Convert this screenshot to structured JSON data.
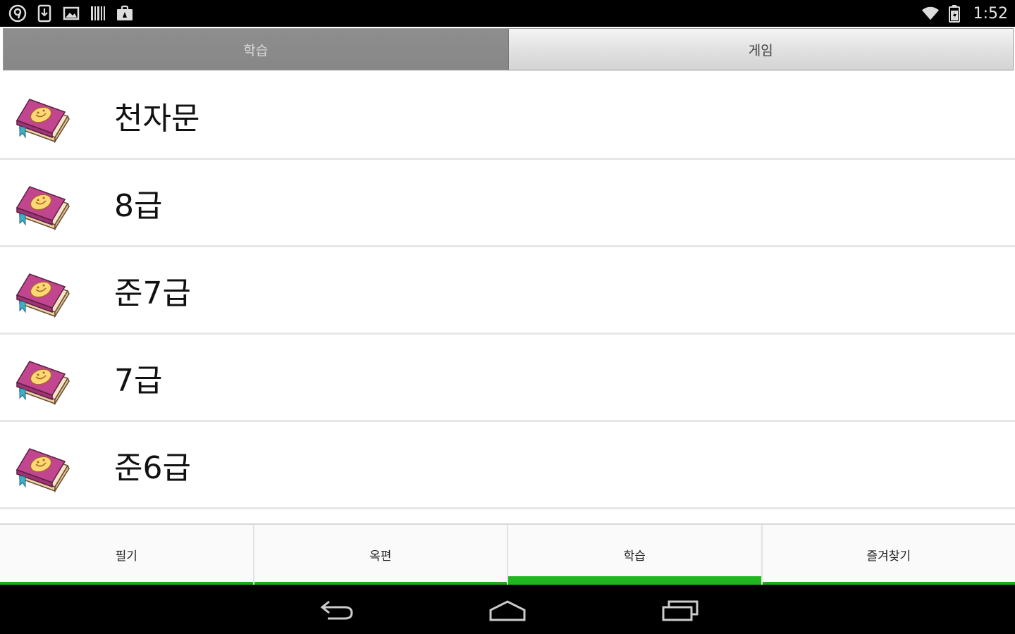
{
  "status_bar": {
    "left_icons": [
      "notification-9-icon",
      "download-icon",
      "image-icon",
      "barcode-icon",
      "shopping-bag-icon"
    ],
    "right_icons": [
      "wifi-icon",
      "battery-icon"
    ],
    "time": "1:52"
  },
  "top_tabs": [
    {
      "label": "학습",
      "active": true
    },
    {
      "label": "게임",
      "active": false
    }
  ],
  "list": {
    "item_icon": "book-icon",
    "items": [
      {
        "label": "천자문"
      },
      {
        "label": "8급"
      },
      {
        "label": "준7급"
      },
      {
        "label": "7급"
      },
      {
        "label": "준6급"
      }
    ]
  },
  "bottom_tabs": [
    {
      "label": "필기",
      "selected": false
    },
    {
      "label": "옥편",
      "selected": false
    },
    {
      "label": "학습",
      "selected": true
    },
    {
      "label": "즐겨찾기",
      "selected": false
    }
  ],
  "nav_bar": {
    "buttons": [
      "back-icon",
      "home-icon",
      "recents-icon"
    ]
  },
  "colors": {
    "accent": "#20b620",
    "active_tab_bg": "#8a8a8a",
    "status_bar_bg": "#000000"
  }
}
